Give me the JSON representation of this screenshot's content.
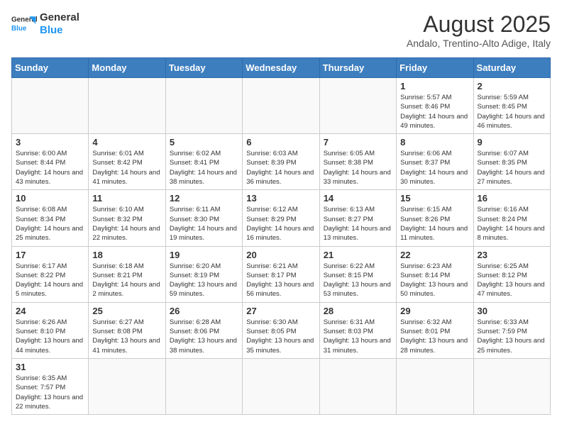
{
  "header": {
    "logo_general": "General",
    "logo_blue": "Blue",
    "month_year": "August 2025",
    "location": "Andalo, Trentino-Alto Adige, Italy"
  },
  "weekdays": [
    "Sunday",
    "Monday",
    "Tuesday",
    "Wednesday",
    "Thursday",
    "Friday",
    "Saturday"
  ],
  "weeks": [
    [
      {
        "day": "",
        "info": ""
      },
      {
        "day": "",
        "info": ""
      },
      {
        "day": "",
        "info": ""
      },
      {
        "day": "",
        "info": ""
      },
      {
        "day": "",
        "info": ""
      },
      {
        "day": "1",
        "info": "Sunrise: 5:57 AM\nSunset: 8:46 PM\nDaylight: 14 hours and 49 minutes."
      },
      {
        "day": "2",
        "info": "Sunrise: 5:59 AM\nSunset: 8:45 PM\nDaylight: 14 hours and 46 minutes."
      }
    ],
    [
      {
        "day": "3",
        "info": "Sunrise: 6:00 AM\nSunset: 8:44 PM\nDaylight: 14 hours and 43 minutes."
      },
      {
        "day": "4",
        "info": "Sunrise: 6:01 AM\nSunset: 8:42 PM\nDaylight: 14 hours and 41 minutes."
      },
      {
        "day": "5",
        "info": "Sunrise: 6:02 AM\nSunset: 8:41 PM\nDaylight: 14 hours and 38 minutes."
      },
      {
        "day": "6",
        "info": "Sunrise: 6:03 AM\nSunset: 8:39 PM\nDaylight: 14 hours and 36 minutes."
      },
      {
        "day": "7",
        "info": "Sunrise: 6:05 AM\nSunset: 8:38 PM\nDaylight: 14 hours and 33 minutes."
      },
      {
        "day": "8",
        "info": "Sunrise: 6:06 AM\nSunset: 8:37 PM\nDaylight: 14 hours and 30 minutes."
      },
      {
        "day": "9",
        "info": "Sunrise: 6:07 AM\nSunset: 8:35 PM\nDaylight: 14 hours and 27 minutes."
      }
    ],
    [
      {
        "day": "10",
        "info": "Sunrise: 6:08 AM\nSunset: 8:34 PM\nDaylight: 14 hours and 25 minutes."
      },
      {
        "day": "11",
        "info": "Sunrise: 6:10 AM\nSunset: 8:32 PM\nDaylight: 14 hours and 22 minutes."
      },
      {
        "day": "12",
        "info": "Sunrise: 6:11 AM\nSunset: 8:30 PM\nDaylight: 14 hours and 19 minutes."
      },
      {
        "day": "13",
        "info": "Sunrise: 6:12 AM\nSunset: 8:29 PM\nDaylight: 14 hours and 16 minutes."
      },
      {
        "day": "14",
        "info": "Sunrise: 6:13 AM\nSunset: 8:27 PM\nDaylight: 14 hours and 13 minutes."
      },
      {
        "day": "15",
        "info": "Sunrise: 6:15 AM\nSunset: 8:26 PM\nDaylight: 14 hours and 11 minutes."
      },
      {
        "day": "16",
        "info": "Sunrise: 6:16 AM\nSunset: 8:24 PM\nDaylight: 14 hours and 8 minutes."
      }
    ],
    [
      {
        "day": "17",
        "info": "Sunrise: 6:17 AM\nSunset: 8:22 PM\nDaylight: 14 hours and 5 minutes."
      },
      {
        "day": "18",
        "info": "Sunrise: 6:18 AM\nSunset: 8:21 PM\nDaylight: 14 hours and 2 minutes."
      },
      {
        "day": "19",
        "info": "Sunrise: 6:20 AM\nSunset: 8:19 PM\nDaylight: 13 hours and 59 minutes."
      },
      {
        "day": "20",
        "info": "Sunrise: 6:21 AM\nSunset: 8:17 PM\nDaylight: 13 hours and 56 minutes."
      },
      {
        "day": "21",
        "info": "Sunrise: 6:22 AM\nSunset: 8:15 PM\nDaylight: 13 hours and 53 minutes."
      },
      {
        "day": "22",
        "info": "Sunrise: 6:23 AM\nSunset: 8:14 PM\nDaylight: 13 hours and 50 minutes."
      },
      {
        "day": "23",
        "info": "Sunrise: 6:25 AM\nSunset: 8:12 PM\nDaylight: 13 hours and 47 minutes."
      }
    ],
    [
      {
        "day": "24",
        "info": "Sunrise: 6:26 AM\nSunset: 8:10 PM\nDaylight: 13 hours and 44 minutes."
      },
      {
        "day": "25",
        "info": "Sunrise: 6:27 AM\nSunset: 8:08 PM\nDaylight: 13 hours and 41 minutes."
      },
      {
        "day": "26",
        "info": "Sunrise: 6:28 AM\nSunset: 8:06 PM\nDaylight: 13 hours and 38 minutes."
      },
      {
        "day": "27",
        "info": "Sunrise: 6:30 AM\nSunset: 8:05 PM\nDaylight: 13 hours and 35 minutes."
      },
      {
        "day": "28",
        "info": "Sunrise: 6:31 AM\nSunset: 8:03 PM\nDaylight: 13 hours and 31 minutes."
      },
      {
        "day": "29",
        "info": "Sunrise: 6:32 AM\nSunset: 8:01 PM\nDaylight: 13 hours and 28 minutes."
      },
      {
        "day": "30",
        "info": "Sunrise: 6:33 AM\nSunset: 7:59 PM\nDaylight: 13 hours and 25 minutes."
      }
    ],
    [
      {
        "day": "31",
        "info": "Sunrise: 6:35 AM\nSunset: 7:57 PM\nDaylight: 13 hours and 22 minutes."
      },
      {
        "day": "",
        "info": ""
      },
      {
        "day": "",
        "info": ""
      },
      {
        "day": "",
        "info": ""
      },
      {
        "day": "",
        "info": ""
      },
      {
        "day": "",
        "info": ""
      },
      {
        "day": "",
        "info": ""
      }
    ]
  ]
}
